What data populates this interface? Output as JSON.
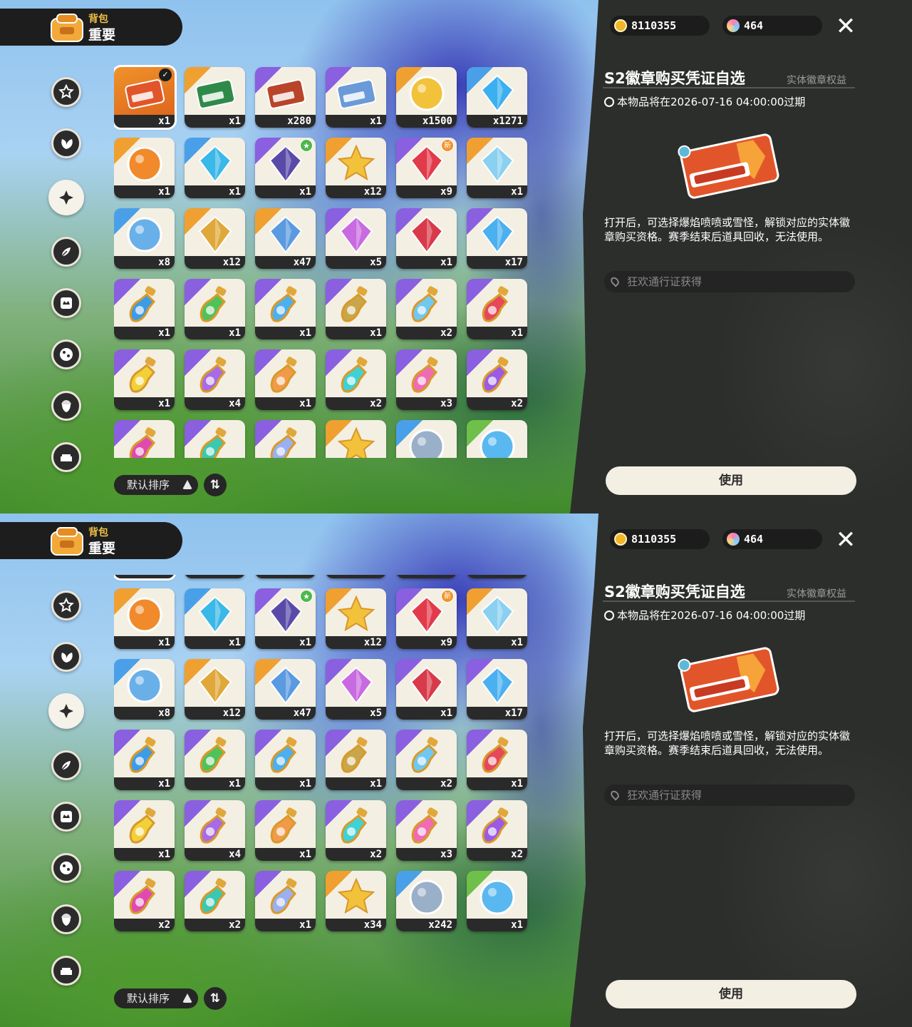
{
  "header": {
    "bag_label": "背包",
    "title": "重要"
  },
  "categories": [
    {
      "name": "star-badge"
    },
    {
      "name": "leaf-cluster"
    },
    {
      "name": "sparkle-star",
      "active": true
    },
    {
      "name": "leaf-pair"
    },
    {
      "name": "crown-card"
    },
    {
      "name": "dots-ball"
    },
    {
      "name": "acorn"
    },
    {
      "name": "sofa"
    }
  ],
  "items": [
    {
      "qty": "x1",
      "rarity": "selected",
      "art": "ticket",
      "badge": "check"
    },
    {
      "qty": "x1",
      "rarity": "orange",
      "art": "envelope"
    },
    {
      "qty": "x280",
      "rarity": "purple",
      "art": "photo-card"
    },
    {
      "qty": "x1",
      "rarity": "purple",
      "art": "letter"
    },
    {
      "qty": "x1500",
      "rarity": "orange",
      "art": "camera"
    },
    {
      "qty": "x1271",
      "rarity": "blue",
      "art": "prism"
    },
    {
      "qty": "x1",
      "rarity": "orange",
      "art": "orange-gem"
    },
    {
      "qty": "x1",
      "rarity": "blue",
      "art": "swirl-flask"
    },
    {
      "qty": "x1",
      "rarity": "purple",
      "art": "pouch",
      "badge": "star"
    },
    {
      "qty": "x12",
      "rarity": "orange",
      "art": "gold-star"
    },
    {
      "qty": "x9",
      "rarity": "purple",
      "art": "red-gem",
      "badge": "new"
    },
    {
      "qty": "x1",
      "rarity": "orange",
      "art": "mirror"
    },
    {
      "qty": "x8",
      "rarity": "blue",
      "art": "blue-ring"
    },
    {
      "qty": "x12",
      "rarity": "orange",
      "art": "gold-key"
    },
    {
      "qty": "x47",
      "rarity": "orange",
      "art": "wand"
    },
    {
      "qty": "x5",
      "rarity": "purple",
      "art": "rainbow-flask"
    },
    {
      "qty": "x1",
      "rarity": "purple",
      "art": "red-vial"
    },
    {
      "qty": "x17",
      "rarity": "purple",
      "art": "blue-vial"
    },
    {
      "qty": "x1",
      "rarity": "purple",
      "art": "potion-blue"
    },
    {
      "qty": "x1",
      "rarity": "purple",
      "art": "potion-green"
    },
    {
      "qty": "x1",
      "rarity": "purple",
      "art": "potion-azure"
    },
    {
      "qty": "x1",
      "rarity": "purple",
      "art": "potion-khaki"
    },
    {
      "qty": "x2",
      "rarity": "purple",
      "art": "potion-sky"
    },
    {
      "qty": "x1",
      "rarity": "purple",
      "art": "potion-red"
    },
    {
      "qty": "x1",
      "rarity": "purple",
      "art": "potion-yellow"
    },
    {
      "qty": "x4",
      "rarity": "purple",
      "art": "potion-violet"
    },
    {
      "qty": "x1",
      "rarity": "purple",
      "art": "potion-orange"
    },
    {
      "qty": "x2",
      "rarity": "purple",
      "art": "potion-cyan"
    },
    {
      "qty": "x3",
      "rarity": "purple",
      "art": "potion-pink"
    },
    {
      "qty": "x2",
      "rarity": "purple",
      "art": "potion-purple"
    },
    {
      "qty": "x2",
      "rarity": "purple",
      "art": "potion-magenta"
    },
    {
      "qty": "x2",
      "rarity": "purple",
      "art": "potion-teal"
    },
    {
      "qty": "x1",
      "rarity": "purple",
      "art": "potion-lilac"
    },
    {
      "qty": "x34",
      "rarity": "orange",
      "art": "star-coin"
    },
    {
      "qty": "x242",
      "rarity": "blue",
      "art": "silver-coin"
    },
    {
      "qty": "x1",
      "rarity": "green",
      "art": "crystal-ball"
    }
  ],
  "sort": {
    "label": "默认排序",
    "toggle_icon": "⇅"
  },
  "currency": {
    "gold": "8110355",
    "gems": "464"
  },
  "detail": {
    "name": "S2徽章购买凭证自选",
    "tag": "实体徽章权益",
    "expire": "本物品将在2026-07-16 04:00:00过期",
    "description": "打开后，可选择爆焰喷喷或雪怪，解锁对应的实体徽章购买资格。赛季结束后道具回收，无法使用。",
    "source": "狂欢通行证获得",
    "use_label": "使用"
  },
  "colors": {
    "selected": "#e8782a",
    "orange": "#f0a030",
    "purple": "#8a5fe0",
    "blue": "#4aa0e8",
    "green": "#6ec04a"
  }
}
